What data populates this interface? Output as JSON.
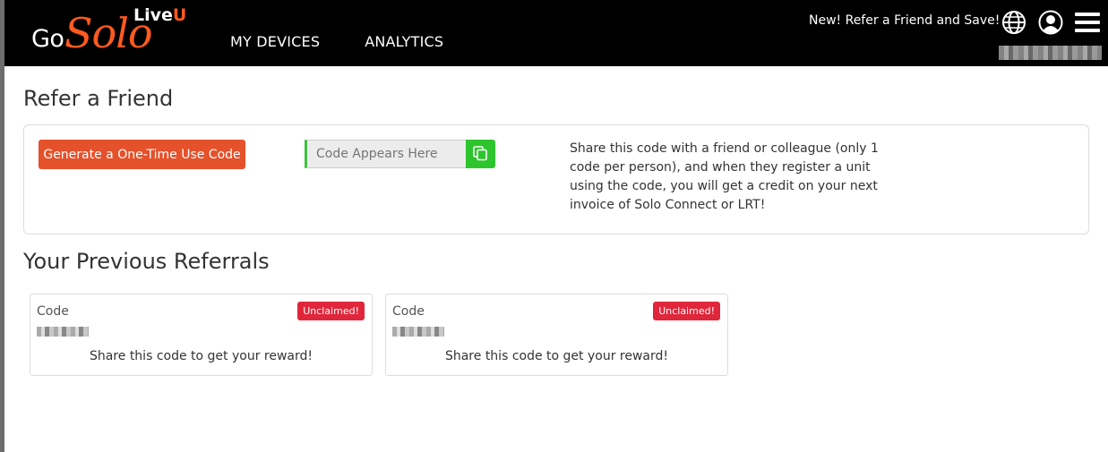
{
  "header": {
    "logo": {
      "go": "Go",
      "solo": "Solo",
      "live": "Live",
      "u": "U"
    },
    "nav": [
      "MY DEVICES",
      "ANALYTICS"
    ],
    "promo": "New! Refer a Friend and Save!",
    "icons": [
      "globe-icon",
      "user-icon",
      "hamburger-menu-icon"
    ]
  },
  "refer": {
    "title": "Refer a Friend",
    "generate_label": "Generate a One-Time Use Code",
    "code_placeholder": "Code Appears Here",
    "description": "Share this code with a friend or colleague (only 1 code per person), and when they register a unit using the code, you will get a credit on your next invoice of Solo Connect or LRT!"
  },
  "referrals": {
    "title": "Your Previous Referrals",
    "items": [
      {
        "code_label": "Code",
        "status": "Unclaimed!",
        "message": "Share this code to get your reward!"
      },
      {
        "code_label": "Code",
        "status": "Unclaimed!",
        "message": "Share this code to get your reward!"
      }
    ]
  },
  "colors": {
    "accent": "#e5512b",
    "copy_button": "#2dc52d",
    "badge": "#e0263a",
    "header_bg": "#000000"
  }
}
